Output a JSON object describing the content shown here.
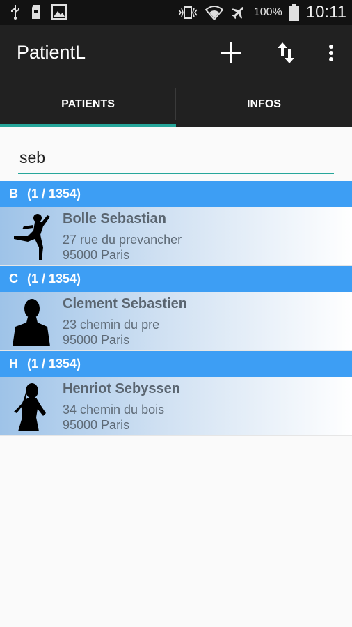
{
  "status_bar": {
    "battery_text": "100%",
    "time": "10:11",
    "icons": [
      "usb-icon",
      "sd-card-icon",
      "image-icon",
      "vibrate-icon",
      "wifi-icon",
      "airplane-icon",
      "battery-icon"
    ]
  },
  "app_bar": {
    "title": "PatientL",
    "actions": [
      "add-icon",
      "sort-icon",
      "overflow-menu-icon"
    ]
  },
  "tabs": [
    {
      "label": "PATIENTS",
      "selected": true
    },
    {
      "label": "INFOS",
      "selected": false
    }
  ],
  "search": {
    "value": "seb"
  },
  "colors": {
    "accent": "#26a69a",
    "section": "#3d9ef4",
    "bar": "#212121"
  },
  "sections": [
    {
      "letter": "B",
      "count": "(1 / 1354)",
      "patient": {
        "name": "Bolle Sebastian",
        "address": "27 rue du prevancher",
        "city": "95000 Paris",
        "avatar": "dancer-silhouette"
      }
    },
    {
      "letter": "C",
      "count": "(1 / 1354)",
      "patient": {
        "name": "Clement Sebastien",
        "address": "23 chemin du pre",
        "city": "95000 Paris",
        "avatar": "man-bust-silhouette"
      }
    },
    {
      "letter": "H",
      "count": "(1 / 1354)",
      "patient": {
        "name": "Henriot Sebyssen",
        "address": "34 chemin du bois",
        "city": "95000 Paris",
        "avatar": "woman-silhouette"
      }
    }
  ]
}
